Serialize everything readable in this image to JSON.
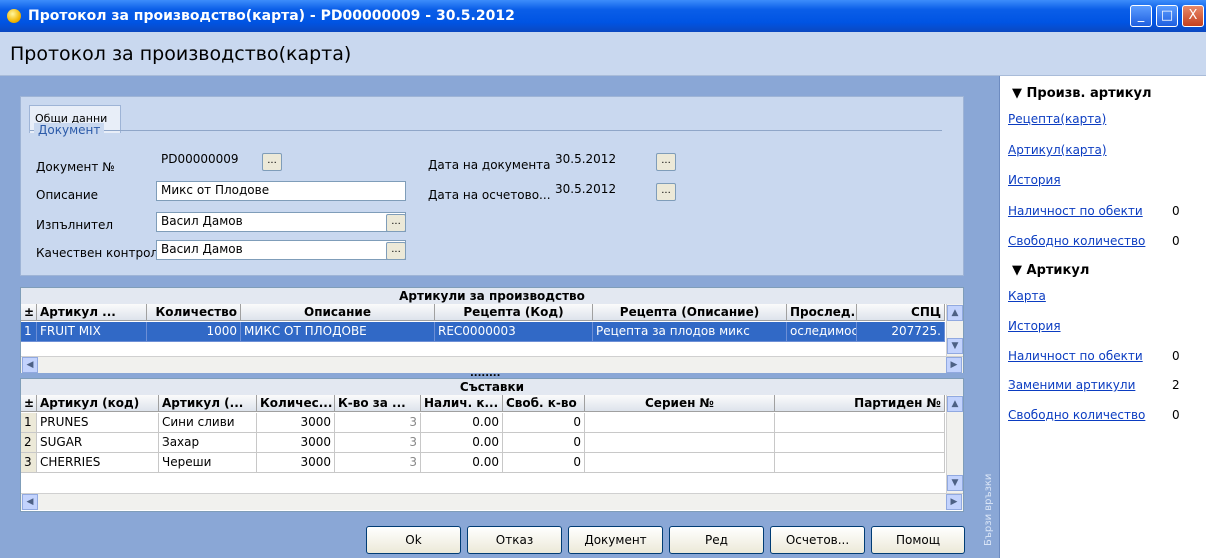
{
  "window": {
    "title": "Протокол за производство(карта) - PD00000009 - 30.5.2012",
    "min": "_",
    "max": "□",
    "close": "X"
  },
  "page": {
    "title": "Протокол за производство(карта)"
  },
  "tabs": [
    {
      "label": "Общи данни"
    }
  ],
  "document": {
    "group_label": "Документ",
    "doc_no_label": "Документ №",
    "doc_no": "PD00000009",
    "description_label": "Описание",
    "description": "Микс от Плодове",
    "executor_label": "Изпълнител",
    "executor": "Васил Дамов",
    "qc_label": "Качествен контрол",
    "qc": "Васил Дамов",
    "doc_date_label": "Дата на документа",
    "doc_date": "30.5.2012",
    "acc_date_label": "Дата на осчетово...",
    "acc_date": "30.5.2012",
    "dots": "..."
  },
  "production": {
    "title": "Артикули за производство",
    "headers": [
      "±",
      "Артикул ...",
      "Количество",
      "Описание",
      "Рецепта (Код)",
      "Рецепта (Описание)",
      "Прослед...",
      "СПЦ"
    ],
    "rows": [
      [
        "1",
        "FRUIT MIX",
        "1000",
        "МИКС ОТ ПЛОДОВЕ",
        "REC0000003",
        "Рецепта за плодов микс",
        "оследимост",
        "207725."
      ]
    ]
  },
  "splitter": "........",
  "components": {
    "title": "Съставки",
    "headers": [
      "±",
      "Артикул (код)",
      "Артикул (...",
      "Количес...",
      "К-во за ...",
      "Налич. к...",
      "Своб. к-во",
      "Сериен №",
      "Партиден №"
    ],
    "rows": [
      [
        "1",
        "PRUNES",
        "Сини сливи",
        "3000",
        "3",
        "0.00",
        "0",
        "",
        ""
      ],
      [
        "2",
        "SUGAR",
        "Захар",
        "3000",
        "3",
        "0.00",
        "0",
        "",
        ""
      ],
      [
        "3",
        "CHERRIES",
        "Череши",
        "3000",
        "3",
        "0.00",
        "0",
        "",
        ""
      ]
    ]
  },
  "buttons": {
    "ok": "Ok",
    "cancel": "Отказ",
    "document": "Документ",
    "row": "Ред",
    "accounting": "Осчетов...",
    "help": "Помощ"
  },
  "quicklinks": {
    "strip_label": "Бързи връзки",
    "section1": {
      "title": "Произв. артикул",
      "links": [
        {
          "label": "Рецепта(карта)",
          "count": ""
        },
        {
          "label": "Артикул(карта)",
          "count": ""
        },
        {
          "label": "История",
          "count": ""
        },
        {
          "label": "Наличност по обекти",
          "count": "0"
        },
        {
          "label": "Свободно количество",
          "count": "0"
        }
      ]
    },
    "section2": {
      "title": "Артикул",
      "links": [
        {
          "label": "Карта",
          "count": ""
        },
        {
          "label": "История",
          "count": ""
        },
        {
          "label": "Наличност по обекти",
          "count": "0"
        },
        {
          "label": "Заменими артикули",
          "count": "2"
        },
        {
          "label": "Свободно количество",
          "count": "0"
        }
      ]
    }
  },
  "colors": {
    "titlebar": "#0054e3",
    "selection": "#3169c6",
    "link": "#0b3cc1"
  }
}
